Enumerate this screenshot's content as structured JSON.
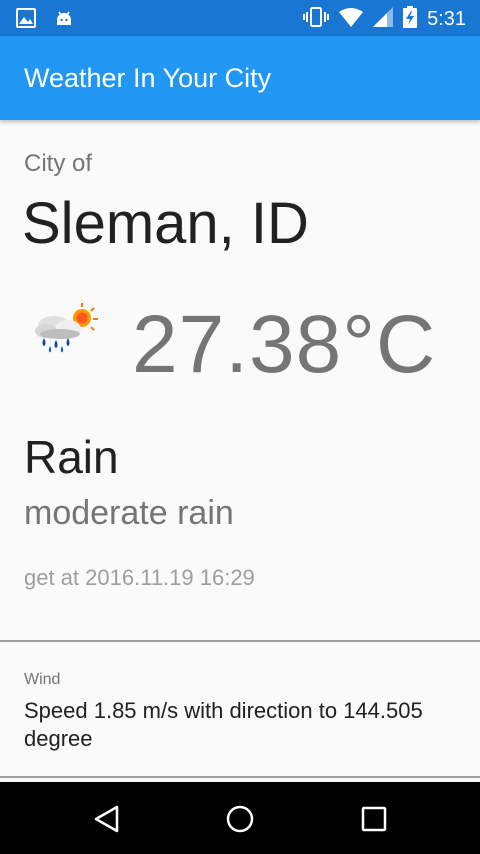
{
  "status_bar": {
    "time": "5:31",
    "icons": [
      "image-icon",
      "android-icon",
      "vibrate-icon",
      "wifi-icon",
      "signal-icon",
      "battery-charging-icon"
    ]
  },
  "app_bar": {
    "title": "Weather In Your City"
  },
  "weather": {
    "city_label": "City of",
    "city_name": "Sleman, ID",
    "icon": "rain-sun-cloud-icon",
    "temperature": "27.38°C",
    "condition": "Rain",
    "description": "moderate rain",
    "fetched_at": "get at 2016.11.19 16:29"
  },
  "wind": {
    "label": "Wind",
    "value": "Speed 1.85 m/s with direction to 144.505 degree"
  },
  "nav_bar": {
    "buttons": [
      "back",
      "home",
      "recents"
    ]
  }
}
